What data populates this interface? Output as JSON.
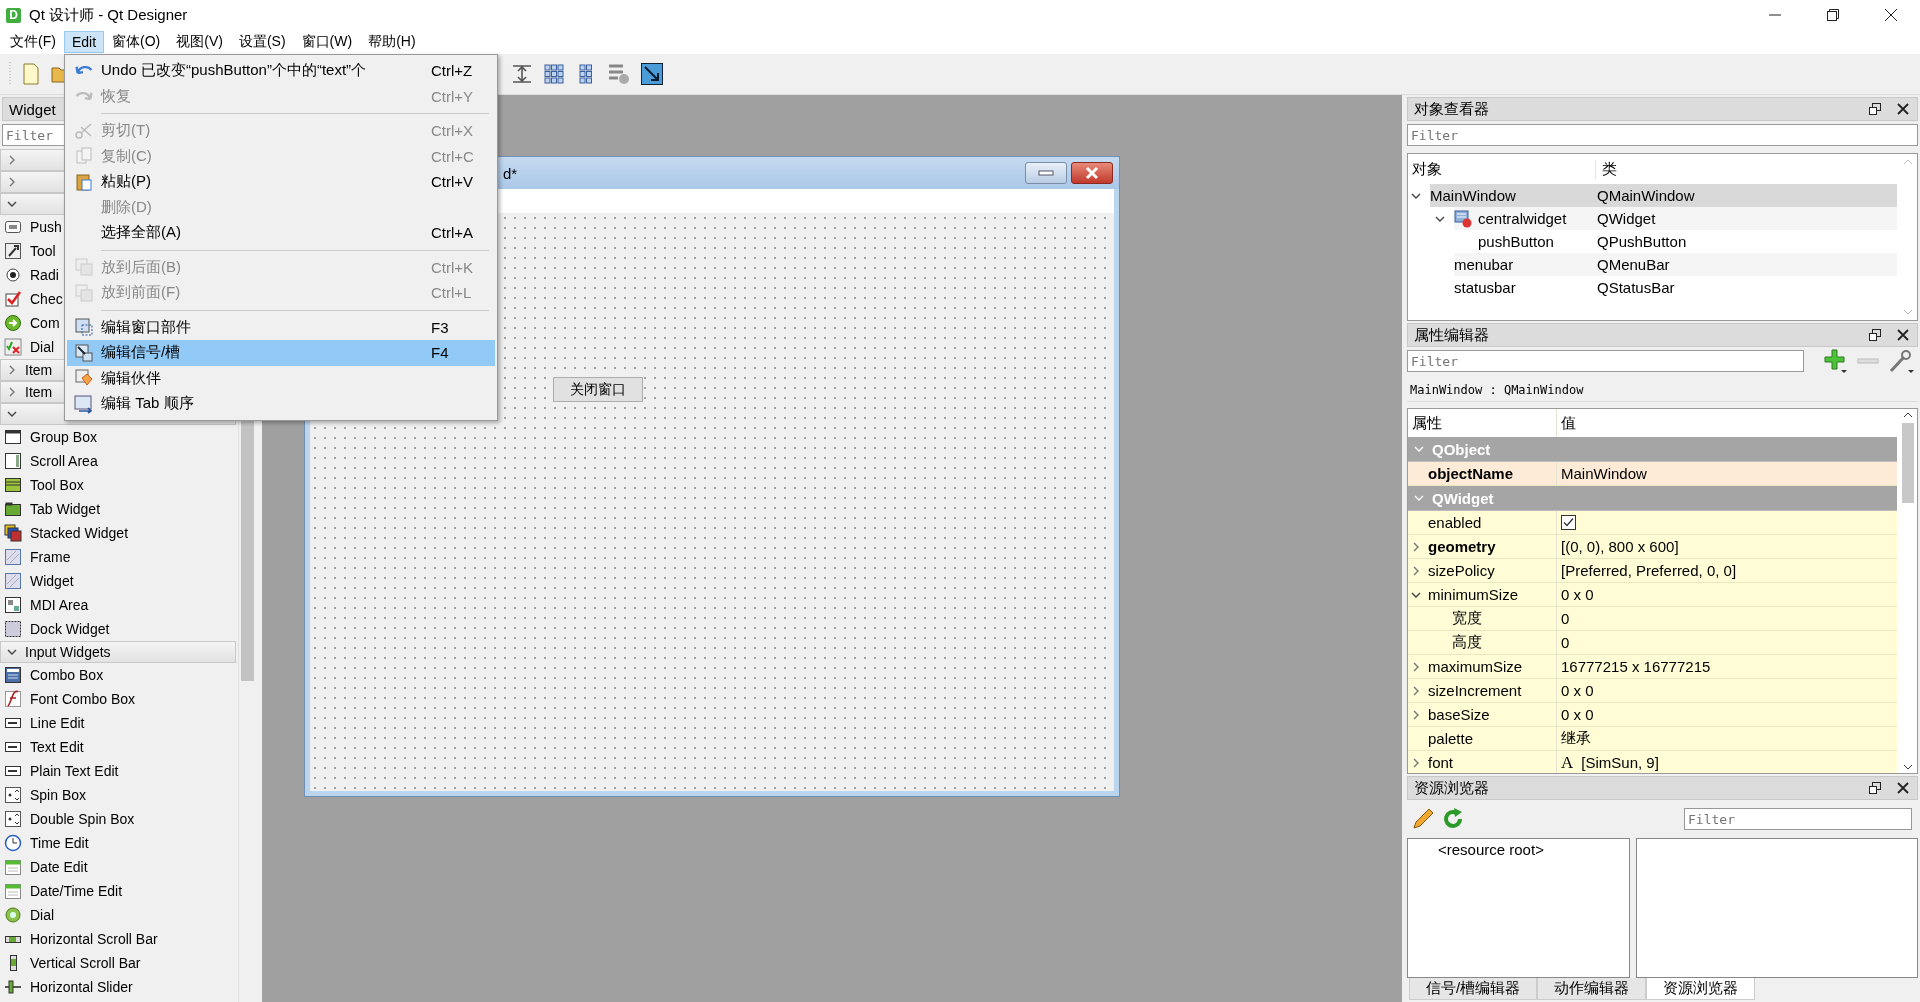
{
  "window": {
    "icon_letter": "D",
    "title": "Qt 设计师 - Qt Designer"
  },
  "menubar": [
    {
      "label": "文件(F)",
      "selected": false
    },
    {
      "label": "Edit",
      "selected": true
    },
    {
      "label": "窗体(O)",
      "selected": false
    },
    {
      "label": "视图(V)",
      "selected": false
    },
    {
      "label": "设置(S)",
      "selected": false
    },
    {
      "label": "窗口(W)",
      "selected": false
    },
    {
      "label": "帮助(H)",
      "selected": false
    }
  ],
  "edit_menu": [
    {
      "kind": "item",
      "label": "Undo 已改变“pushButton”个中的“text”个",
      "shortcut": "Ctrl+Z",
      "disabled": false,
      "selected": false
    },
    {
      "kind": "item",
      "label": "恢复",
      "shortcut": "Ctrl+Y",
      "disabled": true,
      "selected": false
    },
    {
      "kind": "separator"
    },
    {
      "kind": "item",
      "label": "剪切(T)",
      "shortcut": "Ctrl+X",
      "disabled": true,
      "selected": false
    },
    {
      "kind": "item",
      "label": "复制(C)",
      "shortcut": "Ctrl+C",
      "disabled": true,
      "selected": false
    },
    {
      "kind": "item",
      "label": "粘贴(P)",
      "shortcut": "Ctrl+V",
      "disabled": false,
      "selected": false
    },
    {
      "kind": "item",
      "label": "删除(D)",
      "disabled": true,
      "selected": false
    },
    {
      "kind": "item",
      "label": "选择全部(A)",
      "shortcut": "Ctrl+A",
      "disabled": false,
      "selected": false
    },
    {
      "kind": "separator"
    },
    {
      "kind": "item",
      "label": "放到后面(B)",
      "shortcut": "Ctrl+K",
      "disabled": true,
      "selected": false
    },
    {
      "kind": "item",
      "label": "放到前面(F)",
      "shortcut": "Ctrl+L",
      "disabled": true,
      "selected": false
    },
    {
      "kind": "separator"
    },
    {
      "kind": "item",
      "label": "编辑窗口部件",
      "shortcut": "F3",
      "disabled": false,
      "selected": false
    },
    {
      "kind": "item",
      "label": "编辑信号/槽",
      "shortcut": "F4",
      "disabled": false,
      "selected": true
    },
    {
      "kind": "item",
      "label": "编辑伙伴",
      "disabled": false,
      "selected": false
    },
    {
      "kind": "item",
      "label": "编辑 Tab 顺序",
      "disabled": false,
      "selected": false
    }
  ],
  "widget_box": {
    "title": "Widget",
    "filter_placeholder": "Filter",
    "categories": [
      {
        "expanded": false
      },
      {
        "expanded": false
      },
      {
        "expanded": true,
        "items": [
          "Push",
          "Tool",
          "Radi",
          "Chec",
          "Com",
          "Dial"
        ]
      },
      {
        "label": "Item",
        "expanded": false
      },
      {
        "label": "Item",
        "expanded": false
      },
      {
        "expanded": true,
        "items": [
          "Group Box",
          "Scroll Area",
          "Tool Box",
          "Tab Widget",
          "Stacked Widget",
          "Frame",
          "Widget",
          "MDI Area",
          "Dock Widget"
        ]
      },
      {
        "label": "Input Widgets",
        "expanded": true,
        "items": [
          "Combo Box",
          "Font Combo Box",
          "Line Edit",
          "Text Edit",
          "Plain Text Edit",
          "Spin Box",
          "Double Spin Box",
          "Time Edit",
          "Date Edit",
          "Date/Time Edit",
          "Dial",
          "Horizontal Scroll Bar",
          "Vertical Scroll Bar",
          "Horizontal Slider"
        ]
      }
    ]
  },
  "form_window": {
    "title": "d*",
    "button": "关闭窗口"
  },
  "object_inspector": {
    "title": "对象查看器",
    "filter_placeholder": "Filter",
    "columns": [
      "对象",
      "类"
    ],
    "tree": [
      {
        "name": "MainWindow",
        "class": "QMainWindow",
        "selected": true,
        "expanded": true,
        "children": [
          {
            "name": "centralwidget",
            "class": "QWidget",
            "selected": false,
            "expanded": true,
            "children": [
              {
                "name": "pushButton",
                "class": "QPushButton",
                "selected": false
              }
            ]
          },
          {
            "name": "menubar",
            "class": "QMenuBar",
            "selected": false
          },
          {
            "name": "statusbar",
            "class": "QStatusBar",
            "selected": false
          }
        ]
      }
    ]
  },
  "property_editor": {
    "title": "属性编辑器",
    "filter_placeholder": "Filter",
    "object_label": "MainWindow : QMainWindow",
    "columns": [
      "属性",
      "值"
    ],
    "rows": [
      {
        "kind": "group",
        "name": "QObject",
        "expanded": true
      },
      {
        "kind": "text",
        "name": "objectName",
        "value": "MainWindow",
        "modified": true,
        "selected": true
      },
      {
        "kind": "group",
        "name": "QWidget",
        "expanded": true
      },
      {
        "kind": "checkbox",
        "name": "enabled",
        "checked": true,
        "modified": false,
        "selected": false
      },
      {
        "kind": "text",
        "name": "geometry",
        "value": "[(0, 0), 800 x 600]",
        "modified": true,
        "selected": false,
        "expanded": false
      },
      {
        "kind": "text",
        "name": "sizePolicy",
        "value": "[Preferred, Preferred, 0, 0]",
        "modified": false,
        "selected": false,
        "expanded": false
      },
      {
        "kind": "text",
        "name": "minimumSize",
        "value": "0 x 0",
        "modified": false,
        "selected": false,
        "expanded": true,
        "children": [
          {
            "kind": "text",
            "name": "宽度",
            "value": "0",
            "modified": false,
            "selected": false
          },
          {
            "kind": "text",
            "name": "高度",
            "value": "0",
            "modified": false,
            "selected": false
          }
        ]
      },
      {
        "kind": "text",
        "name": "maximumSize",
        "value": "16777215 x 16777215",
        "modified": false,
        "selected": false,
        "expanded": false
      },
      {
        "kind": "text",
        "name": "sizeIncrement",
        "value": "0 x 0",
        "modified": false,
        "selected": false,
        "expanded": false
      },
      {
        "kind": "text",
        "name": "baseSize",
        "value": "0 x 0",
        "modified": false,
        "selected": false,
        "expanded": false
      },
      {
        "kind": "text",
        "name": "palette",
        "value": "继承",
        "modified": false,
        "selected": false
      },
      {
        "kind": "font",
        "name": "font",
        "preview": "A",
        "value": "[SimSun, 9]",
        "modified": false,
        "selected": false,
        "expanded": false
      }
    ]
  },
  "resource_browser": {
    "title": "资源浏览器",
    "filter_placeholder": "Filter",
    "root": "<resource root>"
  },
  "bottom_tabs": [
    {
      "label": "信号/槽编辑器",
      "selected": false
    },
    {
      "label": "动作编辑器",
      "selected": false
    },
    {
      "label": "资源浏览器",
      "selected": true
    }
  ]
}
